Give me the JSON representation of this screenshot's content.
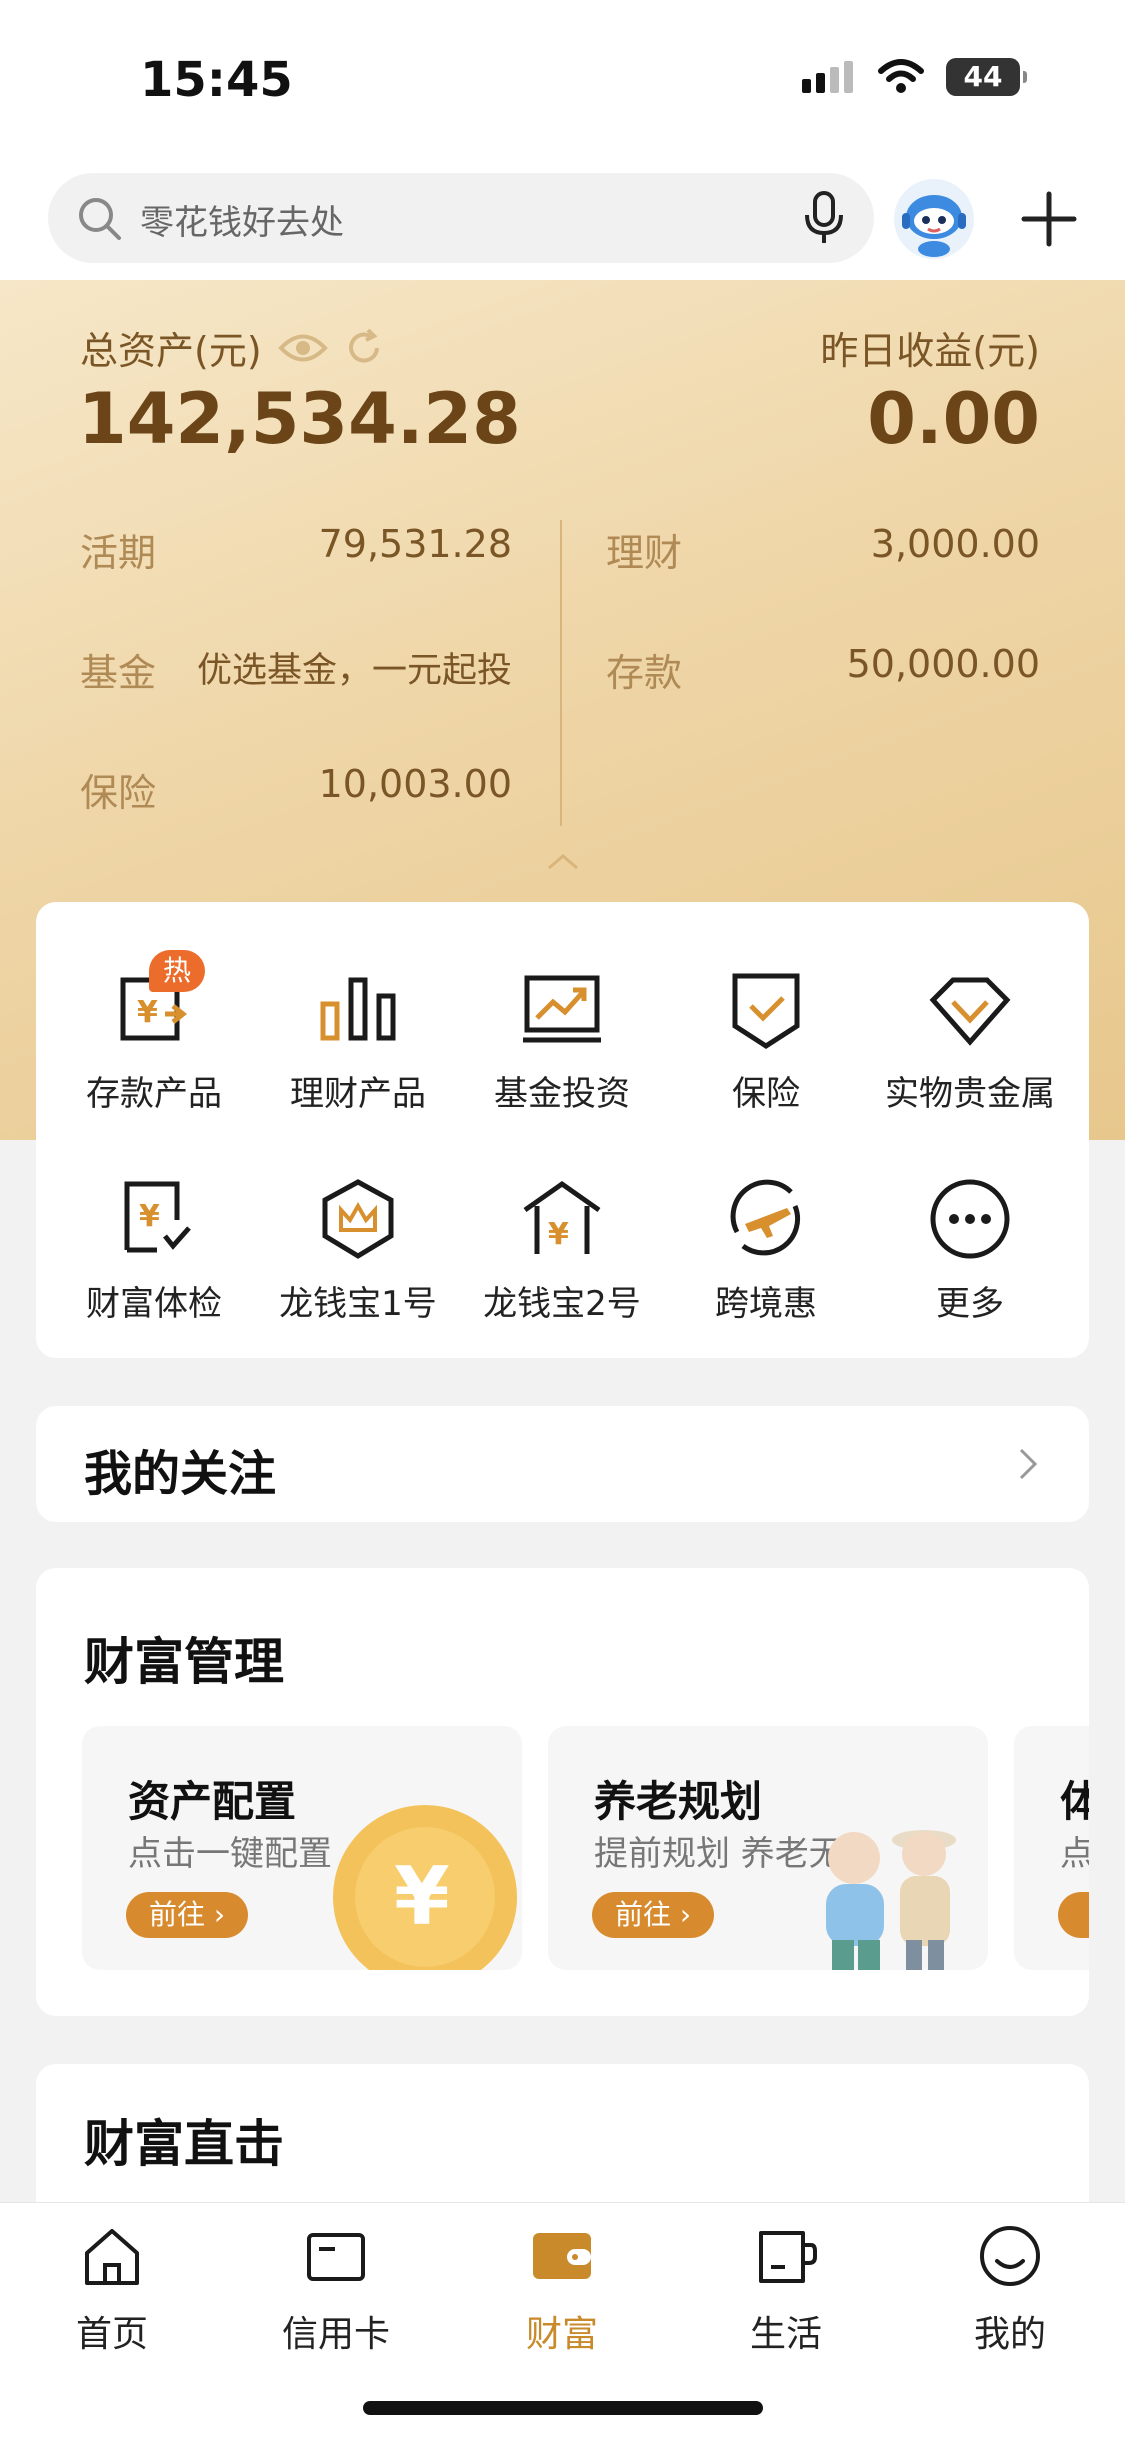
{
  "status_bar": {
    "time": "15:45",
    "battery": "44"
  },
  "search": {
    "placeholder": "零花钱好去处"
  },
  "assets": {
    "total_label": "总资产(元)",
    "total_value": "142,534.28",
    "yesterday_label": "昨日收益(元)",
    "yesterday_value": "0.00",
    "rows": [
      {
        "label": "活期",
        "value": "79,531.28"
      },
      {
        "label": "理财",
        "value": "3,000.00"
      },
      {
        "label": "基金",
        "value": "优选基金，一元起投"
      },
      {
        "label": "存款",
        "value": "50,000.00"
      },
      {
        "label": "保险",
        "value": "10,003.00"
      }
    ]
  },
  "services": [
    {
      "label": "存款产品",
      "icon": "deposit-icon",
      "badge": "热"
    },
    {
      "label": "理财产品",
      "icon": "bar-chart-icon"
    },
    {
      "label": "基金投资",
      "icon": "trend-monitor-icon"
    },
    {
      "label": "保险",
      "icon": "shield-check-icon"
    },
    {
      "label": "实物贵金属",
      "icon": "diamond-icon"
    },
    {
      "label": "财富体检",
      "icon": "wealth-check-icon"
    },
    {
      "label": "龙钱宝1号",
      "icon": "crown-hexagon-icon"
    },
    {
      "label": "龙钱宝2号",
      "icon": "house-yen-icon"
    },
    {
      "label": "跨境惠",
      "icon": "plane-icon"
    },
    {
      "label": "更多",
      "icon": "more-icon"
    }
  ],
  "follow": {
    "title": "我的关注"
  },
  "wealth_management": {
    "title": "财富管理",
    "cards": [
      {
        "title": "资产配置",
        "desc": "点击一键配置",
        "button": "前往 ›"
      },
      {
        "title": "养老规划",
        "desc": "提前规划 养老无忧",
        "button": "前往 ›"
      },
      {
        "title": "体",
        "desc": "点",
        "button": "前"
      }
    ]
  },
  "wealth_direct": {
    "title": "财富直击"
  },
  "tabs": [
    {
      "label": "首页",
      "icon": "home-icon"
    },
    {
      "label": "信用卡",
      "icon": "credit-card-icon"
    },
    {
      "label": "财富",
      "icon": "wallet-icon",
      "active": true
    },
    {
      "label": "生活",
      "icon": "cup-icon"
    },
    {
      "label": "我的",
      "icon": "smile-icon"
    }
  ],
  "colors": {
    "accent": "#c98a2c",
    "gold_text": "#6b4518",
    "badge": "#ec6d2b"
  }
}
